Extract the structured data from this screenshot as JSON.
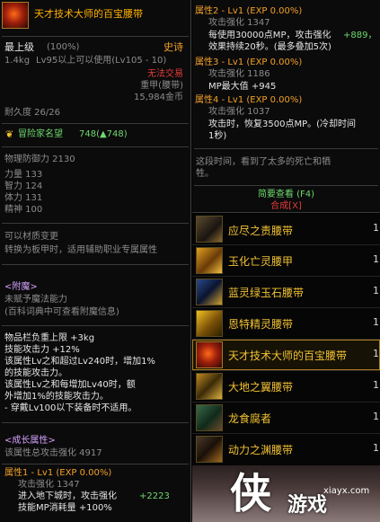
{
  "item": {
    "name": "天才技术大师的百宝腰带",
    "level_req_label": "最上级",
    "percent": "(100%)",
    "rarity": "史诗",
    "weight": "1.4kg",
    "usable": "Lv95以上可以使用(Lv105 - 10)",
    "trade": "无法交易",
    "type": "重甲(腰带)",
    "price": "15,984金币",
    "durability": "耐久度 26/26",
    "fame_label": "冒险家名望",
    "fame_value": "748(▲748)"
  },
  "stats": {
    "phys_def": "物理防御力 2130",
    "str": "力量 133",
    "int": "智力 124",
    "vit": "体力 131",
    "spi": "精神 100"
  },
  "material": {
    "line1": "可以材质变更",
    "line2": "转换为板甲时，适用辅助职业专属属性"
  },
  "enchant": {
    "title": "<附魔>",
    "line1": "未赋予魔法能力",
    "line2": "(百科词典中可查看附魔信息)"
  },
  "options": {
    "lines": [
      "物品栏负重上限 +3kg",
      "技能攻击力 +12%",
      "该属性Lv之和超过Lv240时，增加1%",
      "的技能攻击力。",
      "该属性Lv之和每增加Lv40时，额",
      "外增加1%的技能攻击力。",
      "- 穿戴Lv100以下装备时不适用。"
    ]
  },
  "growth": {
    "title": "<成长属性>",
    "total": "该属性总攻击强化 4917",
    "attr1": {
      "header": "属性1 - Lv1 (EXP 0.00%)",
      "atk": "攻击强化 1347",
      "line1": "进入地下城时，攻击强化",
      "line1_val": "+2223",
      "line2": "技能MP消耗量 +100%"
    }
  },
  "right_tooltip": {
    "attr2_header": "属性2 - Lv1 (EXP 0.00%)",
    "attr2_atk": "攻击强化 1347",
    "attr2_line1": "每使用30000点MP，攻击强化",
    "attr2_line1_val": "+889，",
    "attr2_line2": "效果持续20秒。(最多叠加5次)",
    "attr3_header": "属性3 - Lv1 (EXP 0.00%)",
    "attr3_atk": "攻击强化 1186",
    "attr3_line1": "MP最大值 +945",
    "attr4_header": "属性4 - Lv1 (EXP 0.00%)",
    "attr4_atk": "攻击强化 1037",
    "attr4_line1": "攻击时，恢复3500点MP。(冷却时间",
    "attr4_line2": "1秒)",
    "flavor1": "这段时间，看到了太多的死亡和牺",
    "flavor2": "牲。",
    "simple_view": "简要查看 (F4)",
    "compose": "合成[X]"
  },
  "list": {
    "items": [
      {
        "label": "应尽之责腰带",
        "num": "1"
      },
      {
        "label": "玉化亡灵腰甲",
        "num": "1"
      },
      {
        "label": "蓝灵绿玉石腰带",
        "num": "1"
      },
      {
        "label": "恩特精灵腰带",
        "num": "1"
      },
      {
        "label": "天才技术大师的百宝腰带",
        "num": "1"
      },
      {
        "label": "大地之翼腰带",
        "num": "1"
      },
      {
        "label": "龙食腐者",
        "num": "1"
      },
      {
        "label": "动力之渊腰带",
        "num": "1"
      }
    ]
  },
  "watermark": {
    "site": "xiayx.com",
    "brand": "游戏",
    "logo_char": "侠"
  }
}
